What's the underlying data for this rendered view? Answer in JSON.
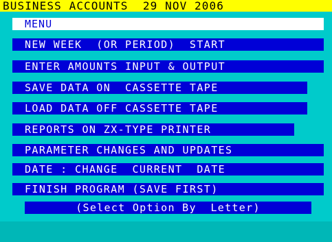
{
  "title_bar": {
    "text": "BUSINESS ACCOUNTS  29 NOV 2006"
  },
  "menu": {
    "header": "MENU",
    "items": [
      "NEW WEEK  (OR PERIOD)  START",
      "ENTER AMOUNTS INPUT & OUTPUT",
      "SAVE DATA ON  CASSETTE TAPE",
      "LOAD DATA OFF CASSETTE TAPE",
      "REPORTS ON ZX-TYPE PRINTER",
      "PARAMETER CHANGES AND UPDATES",
      "DATE : CHANGE  CURRENT  DATE",
      "FINISH PROGRAM (SAVE FIRST)"
    ],
    "footer": "(Select Option By  Letter)"
  },
  "colors": {
    "screen_background": "#00cbcb",
    "title_background": "#ffff00",
    "title_text": "#000000",
    "menu_header_background": "#ffffff",
    "menu_header_text": "#0000d7",
    "item_background": "#0000d7",
    "item_text": "#ffffff",
    "bottom_border": "#00b7b7"
  }
}
